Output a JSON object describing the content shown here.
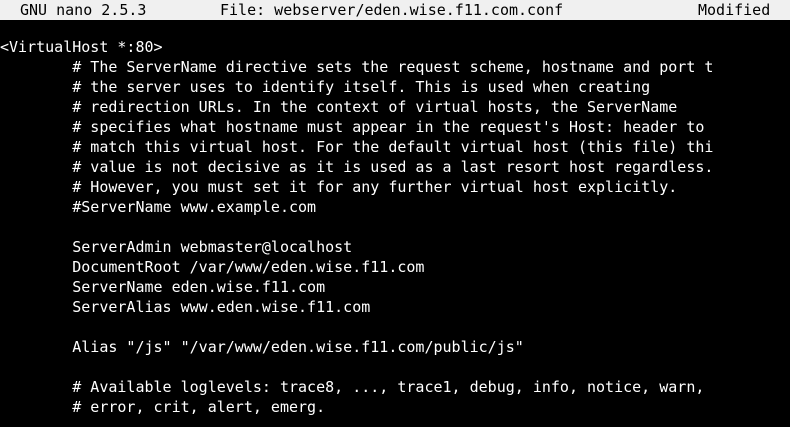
{
  "titlebar": {
    "app": "GNU nano 2.5.3",
    "file": "File: webserver/eden.wise.f11.com.conf",
    "status": "Modified"
  },
  "lines": [
    "<VirtualHost *:80>",
    "        # The ServerName directive sets the request scheme, hostname and port t",
    "        # the server uses to identify itself. This is used when creating",
    "        # redirection URLs. In the context of virtual hosts, the ServerName",
    "        # specifies what hostname must appear in the request's Host: header to",
    "        # match this virtual host. For the default virtual host (this file) thi",
    "        # value is not decisive as it is used as a last resort host regardless.",
    "        # However, you must set it for any further virtual host explicitly.",
    "        #ServerName www.example.com",
    "",
    "        ServerAdmin webmaster@localhost",
    "        DocumentRoot /var/www/eden.wise.f11.com",
    "        ServerName eden.wise.f11.com",
    "        ServerAlias www.eden.wise.f11.com",
    "",
    "        Alias \"/js\" \"/var/www/eden.wise.f11.com/public/js\"",
    "",
    "        # Available loglevels: trace8, ..., trace1, debug, info, notice, warn,",
    "        # error, crit, alert, emerg."
  ],
  "colors": {
    "background": "#000000",
    "text": "#ffffff",
    "titlebar_bg": "#f0f0f0",
    "titlebar_text": "#000000"
  }
}
